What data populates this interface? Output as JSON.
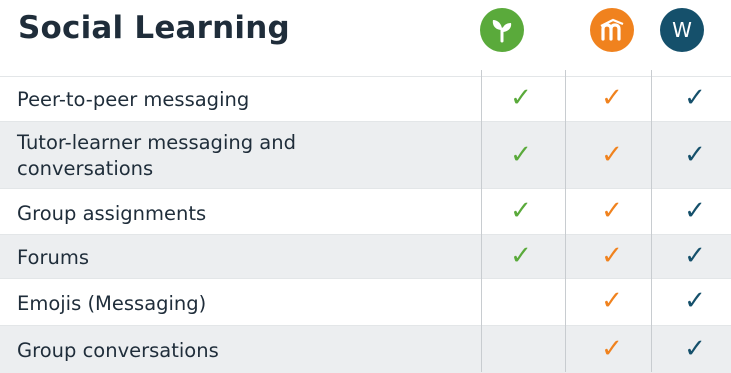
{
  "title": "Social Learning",
  "logos": [
    {
      "name": "leaf-logo",
      "color": "#5aaa3b"
    },
    {
      "name": "moodle-logo",
      "color": "#f0821e"
    },
    {
      "name": "w-logo",
      "letter": "W",
      "color": "#15506b"
    }
  ],
  "rows": [
    {
      "label": "Peer-to-peer messaging",
      "green": true,
      "orange": true,
      "teal": true
    },
    {
      "label_line1": "Tutor-learner messaging and",
      "label_line2": "conversations",
      "green": true,
      "orange": true,
      "teal": true
    },
    {
      "label": "Group assignments",
      "green": true,
      "orange": true,
      "teal": true
    },
    {
      "label": "Forums",
      "green": true,
      "orange": true,
      "teal": true
    },
    {
      "label": "Emojis (Messaging)",
      "green": false,
      "orange": true,
      "teal": true
    },
    {
      "label": "Group conversations",
      "green": false,
      "orange": true,
      "teal": true
    }
  ],
  "checkmark": "✓"
}
